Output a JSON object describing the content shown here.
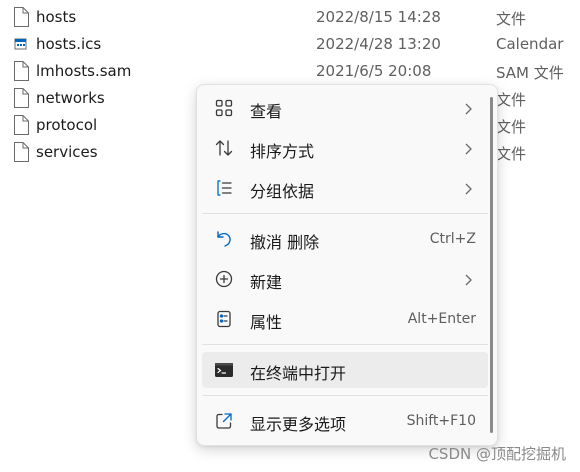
{
  "files": [
    {
      "name": "hosts",
      "date": "2022/8/15 14:28",
      "type": "文件",
      "icon": "file-icon"
    },
    {
      "name": "hosts.ics",
      "date": "2022/4/28 13:20",
      "type": "Calendar",
      "icon": "calendar-file-icon"
    },
    {
      "name": "lmhosts.sam",
      "date": "2021/6/5 20:08",
      "type": "SAM 文件",
      "icon": "file-icon"
    },
    {
      "name": "networks",
      "date": "",
      "type": "文件",
      "icon": "file-icon"
    },
    {
      "name": "protocol",
      "date": "",
      "type": "文件",
      "icon": "file-icon"
    },
    {
      "name": "services",
      "date": "",
      "type": "文件",
      "icon": "file-icon"
    }
  ],
  "menu": {
    "items": [
      {
        "label": "查看",
        "shortcut": "",
        "icon": "grid-view-icon",
        "submenu": true
      },
      {
        "label": "排序方式",
        "shortcut": "",
        "icon": "sort-arrows-icon",
        "submenu": true
      },
      {
        "label": "分组依据",
        "shortcut": "",
        "icon": "group-by-icon",
        "submenu": true
      },
      {
        "label": "撤消 删除",
        "shortcut": "Ctrl+Z",
        "icon": "undo-icon",
        "submenu": false
      },
      {
        "label": "新建",
        "shortcut": "",
        "icon": "add-circle-icon",
        "submenu": true
      },
      {
        "label": "属性",
        "shortcut": "Alt+Enter",
        "icon": "properties-icon",
        "submenu": false
      },
      {
        "label": "在终端中打开",
        "shortcut": "",
        "icon": "terminal-icon",
        "submenu": false
      },
      {
        "label": "显示更多选项",
        "shortcut": "Shift+F10",
        "icon": "share-external-icon",
        "submenu": false
      }
    ],
    "hovered_item": "在终端中打开"
  },
  "colors": {
    "accent": "#0067c0",
    "menu_background": "#f9f9f9",
    "hover_background": "#ececec"
  },
  "watermark": "CSDN @顶配挖掘机"
}
